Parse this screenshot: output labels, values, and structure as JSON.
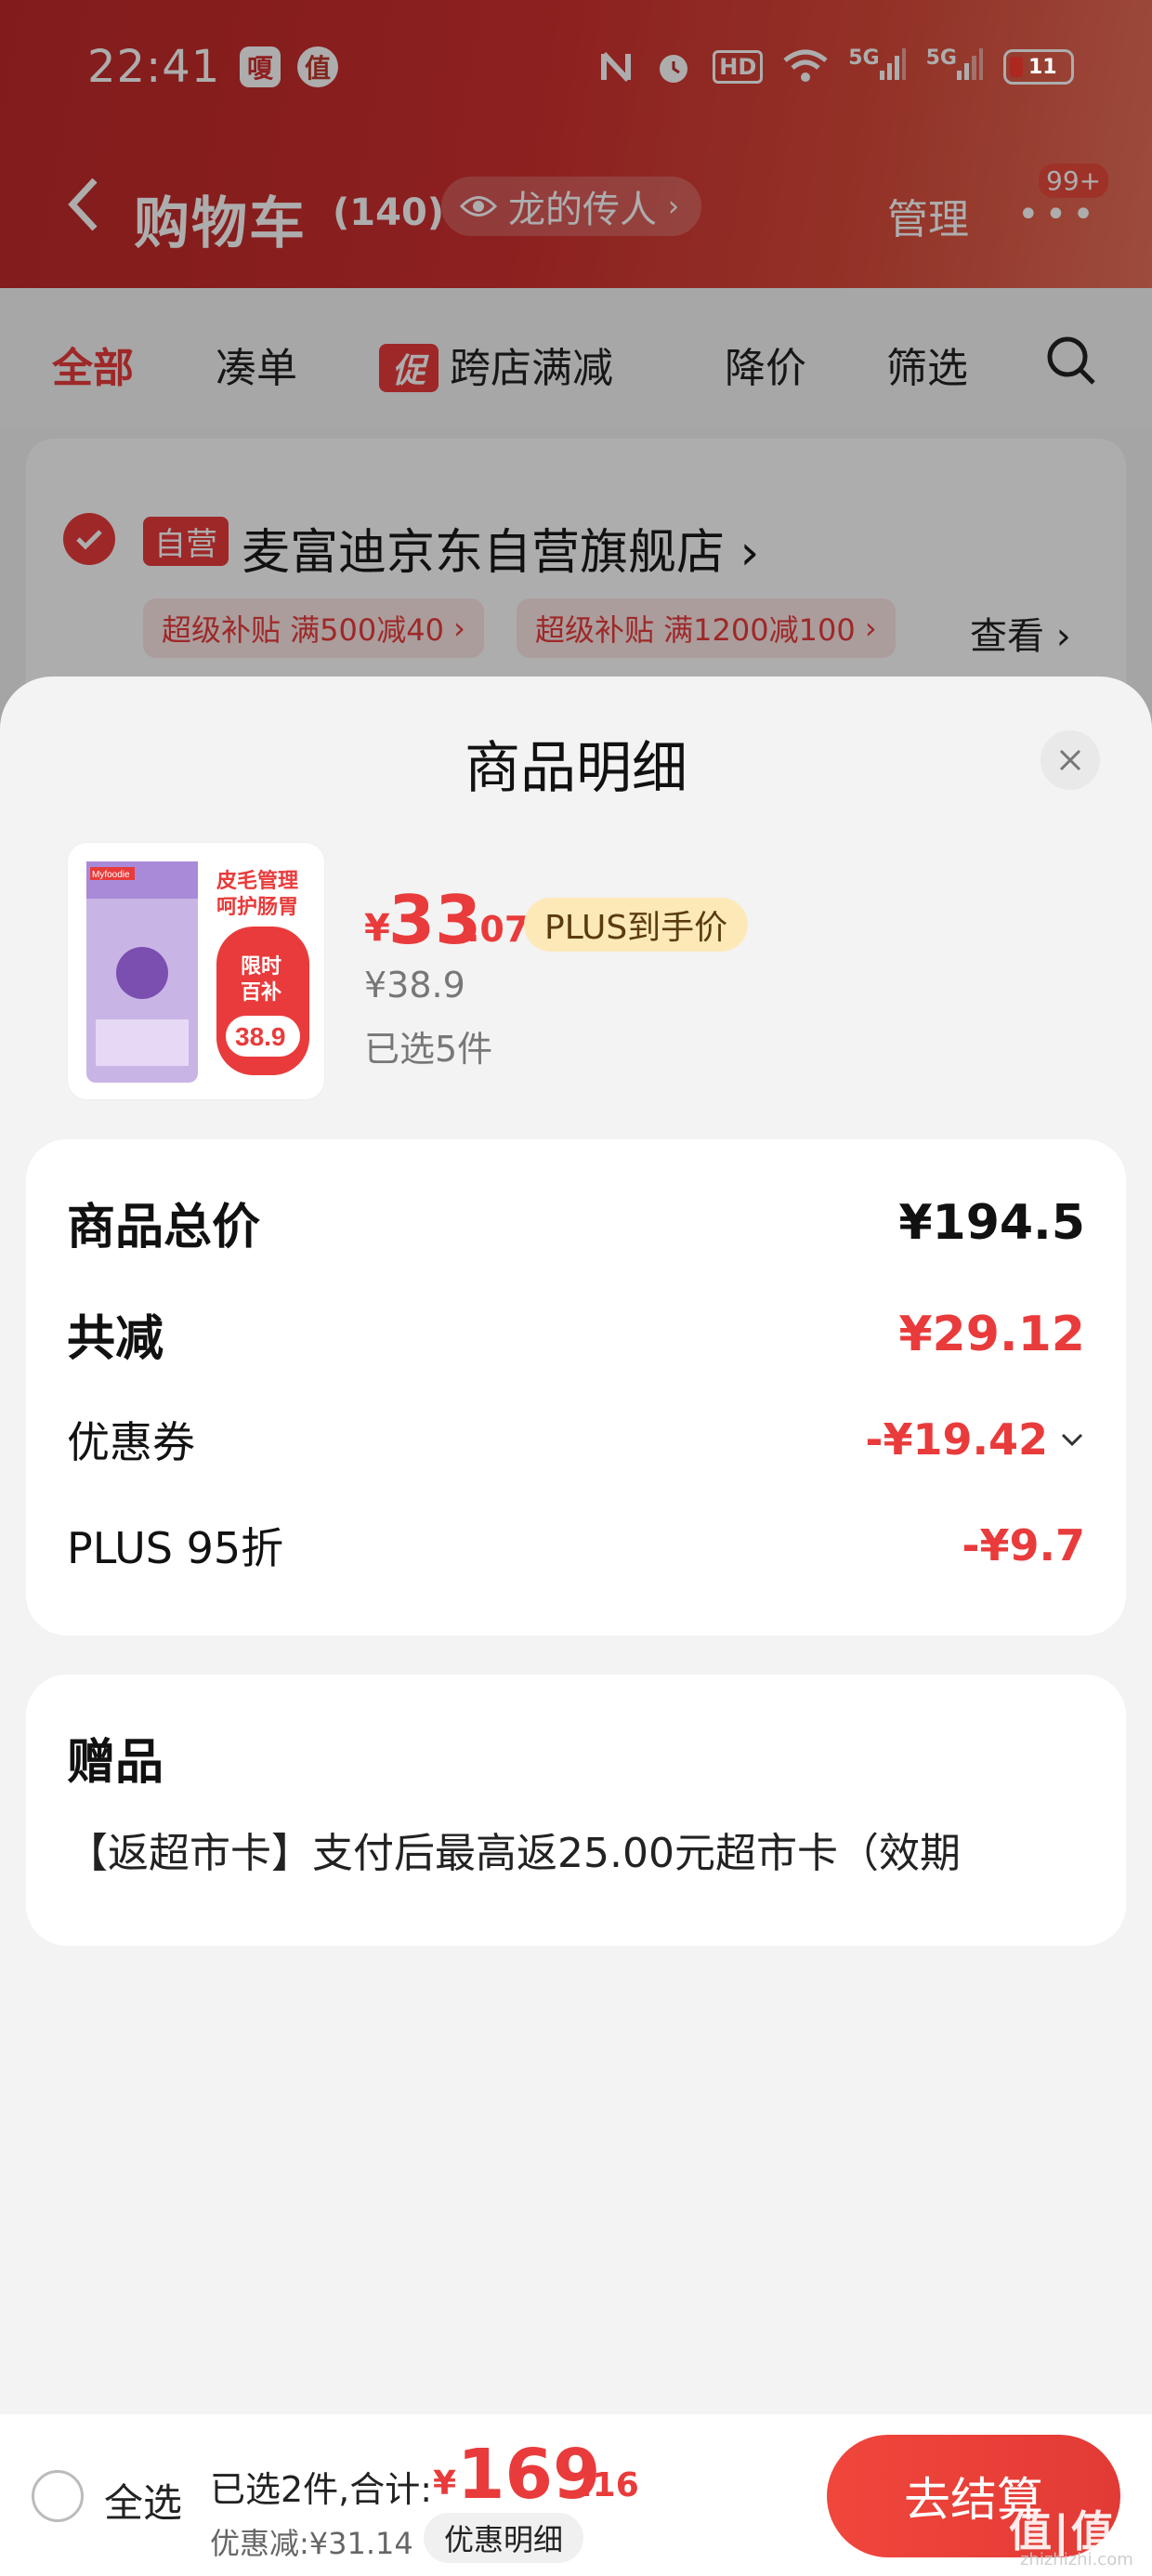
{
  "status_bar": {
    "time": "22:41",
    "app_badge_1": "嗄",
    "app_badge_2": "值",
    "icons": [
      "nfc-icon",
      "alarm-icon",
      "hd-icon",
      "wifi-icon",
      "signal-5g-icon",
      "signal-5g-icon"
    ],
    "hd_label": "HD",
    "signal_label_1": "5G",
    "signal_label_2": "5G",
    "battery": "11"
  },
  "header": {
    "title": "购物车",
    "count": "(140)",
    "user": "龙的传人",
    "manage": "管理",
    "more_badge": "99+"
  },
  "filters": {
    "all": "全部",
    "combine": "凑单",
    "promo_tag": "促",
    "cross_store": "跨店满减",
    "price_drop": "降价",
    "filter": "筛选"
  },
  "store": {
    "self_tag": "自营",
    "name": "麦富迪京东自营旗舰店",
    "coupons": [
      "超级补贴 满500减40",
      "超级补贴 满1200减100"
    ],
    "view": "查看"
  },
  "sheet": {
    "title": "商品明细",
    "product": {
      "image_text_brand": "Myfoodie",
      "image_text_line1": "皮毛管理",
      "image_text_line2": "呵护肠胃",
      "image_text_badge1": "限时",
      "image_text_badge2": "百补",
      "image_text_price": "38.9",
      "price_symbol": "¥",
      "price_int": "33",
      "price_dec": ".07",
      "plus_tag": "PLUS到手价",
      "original_price": "¥38.9",
      "selected_qty": "已选5件"
    },
    "price_card": {
      "total_label": "商品总价",
      "total_value": "¥194.5",
      "reduce_label": "共减",
      "reduce_value": "¥29.12",
      "coupon_label": "优惠券",
      "coupon_value": "-¥19.42",
      "plus_label": "PLUS 95折",
      "plus_value": "-¥9.7"
    },
    "gift_card": {
      "title": "赠品",
      "desc": "【返超市卡】支付后最高返25.00元超市卡（效期"
    }
  },
  "checkout": {
    "select_all": "全选",
    "selected": "已选2件,合计:",
    "total_symbol": "¥",
    "total_int": "169",
    "total_dec": ".16",
    "discount": "优惠减:¥31.14",
    "detail_button": "优惠明细",
    "pay_button": "去结算"
  },
  "watermark": {
    "main": "值|值|值",
    "sub": "zhizhizhi.com"
  },
  "colors": {
    "accent": "#e93b3b",
    "header_bg": "#c82c2c",
    "plus_tag_bg": "#fde9b8"
  }
}
